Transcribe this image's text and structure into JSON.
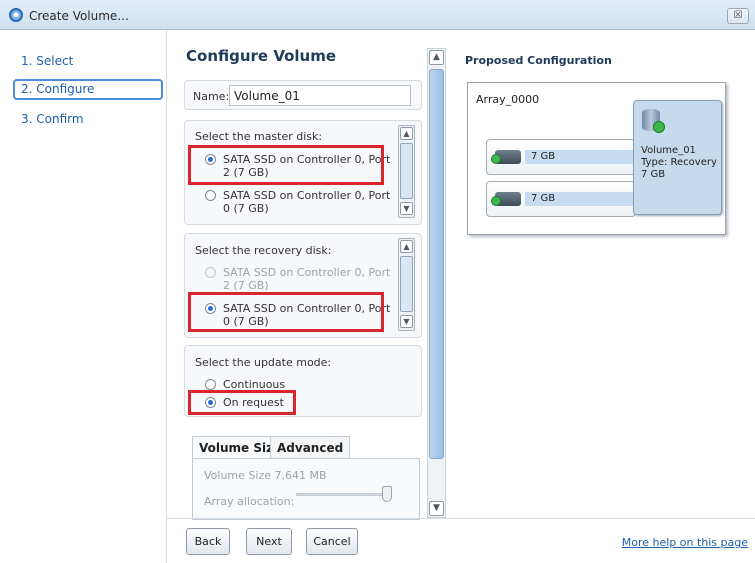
{
  "window": {
    "title": "Create Volume...",
    "close_glyph": "☒"
  },
  "nav": {
    "items": [
      {
        "label": "1. Select"
      },
      {
        "label": "2. Configure",
        "active": true
      },
      {
        "label": "3. Confirm"
      }
    ]
  },
  "main": {
    "title": "Configure Volume",
    "name_label": "Name:",
    "name_value": "Volume_01",
    "master": {
      "label": "Select the master disk:",
      "options": [
        {
          "text": "SATA SSD on Controller 0, Port 2 (7 GB)",
          "checked": true
        },
        {
          "text": "SATA SSD on Controller 0, Port 0 (7 GB)",
          "checked": false
        }
      ]
    },
    "recovery": {
      "label": "Select the recovery disk:",
      "options": [
        {
          "text": "SATA SSD on Controller 0, Port 2 (7 GB)",
          "checked": false,
          "disabled": true
        },
        {
          "text": "SATA SSD on Controller 0, Port 0 (7 GB)",
          "checked": true
        }
      ]
    },
    "update_mode": {
      "label": "Select the update mode:",
      "options": [
        {
          "text": "Continuous",
          "checked": false
        },
        {
          "text": "On request",
          "checked": true
        }
      ]
    },
    "tabs": [
      {
        "label": "Volume Size",
        "active": true
      },
      {
        "label": "Advanced"
      }
    ],
    "volume_size_text": "Volume Size 7,641 MB",
    "array_allocation_label": "Array allocation:",
    "array_allocation_percent": 100
  },
  "proposed": {
    "title": "Proposed Configuration",
    "array_name": "Array_0000",
    "disks": [
      {
        "size": "7 GB"
      },
      {
        "size": "7 GB"
      }
    ],
    "volume": {
      "name": "Volume_01",
      "type": "Type: Recovery",
      "size": "7 GB"
    }
  },
  "footer": {
    "back": "Back",
    "next": "Next",
    "cancel": "Cancel",
    "help": "More help on this page"
  },
  "colors": {
    "accent": "#1e5fa8",
    "highlight": "#d9262c",
    "volume_fill": "#c5daec"
  }
}
